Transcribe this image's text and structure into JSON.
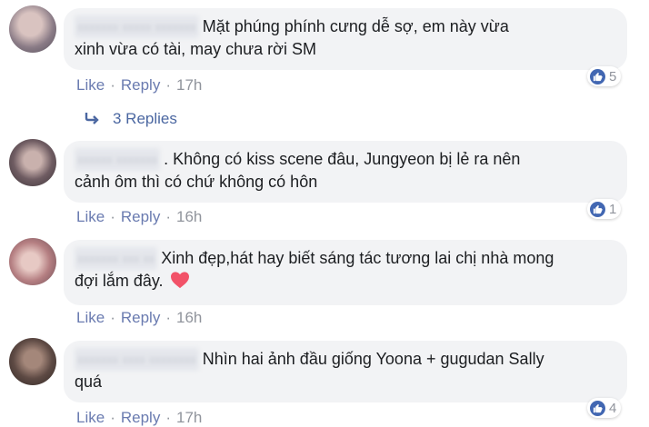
{
  "comments": [
    {
      "text_line1": "Mặt phúng phính cưng dễ sợ, em này vừa",
      "text_line2": "xinh vừa có tài, may chưa rời SM",
      "like": "Like",
      "reply": "Reply",
      "time": "17h",
      "reaction_count": "5"
    },
    {
      "text_line1": ". Không có kiss scene đâu, Jungyeon bị lẻ ra nên",
      "text_line2": "cảnh ôm thì có chứ không có hôn",
      "like": "Like",
      "reply": "Reply",
      "time": "16h",
      "reaction_count": "1"
    },
    {
      "text_line1": "Xinh đẹp,hát hay biết sáng tác tương lai chị nhà mong",
      "text_line2": "đợi lắm đây.",
      "like": "Like",
      "reply": "Reply",
      "time": "16h"
    },
    {
      "text_line1": "Nhìn hai ảnh đầu giống Yoona + gugudan Sally",
      "text_line2": "quá",
      "like": "Like",
      "reply": "Reply",
      "time": "17h",
      "reaction_count": "4"
    }
  ],
  "replies_link": "3 Replies",
  "separator": "·",
  "colors": {
    "bubble": "#f2f3f5",
    "link": "#4b67a1",
    "like_blue": "#4267b2",
    "heart": "#f25268",
    "meta_gray": "#90949c"
  },
  "icons": [
    "reply-arrow-icon",
    "like-reaction-icon",
    "heart-emoji-icon"
  ]
}
